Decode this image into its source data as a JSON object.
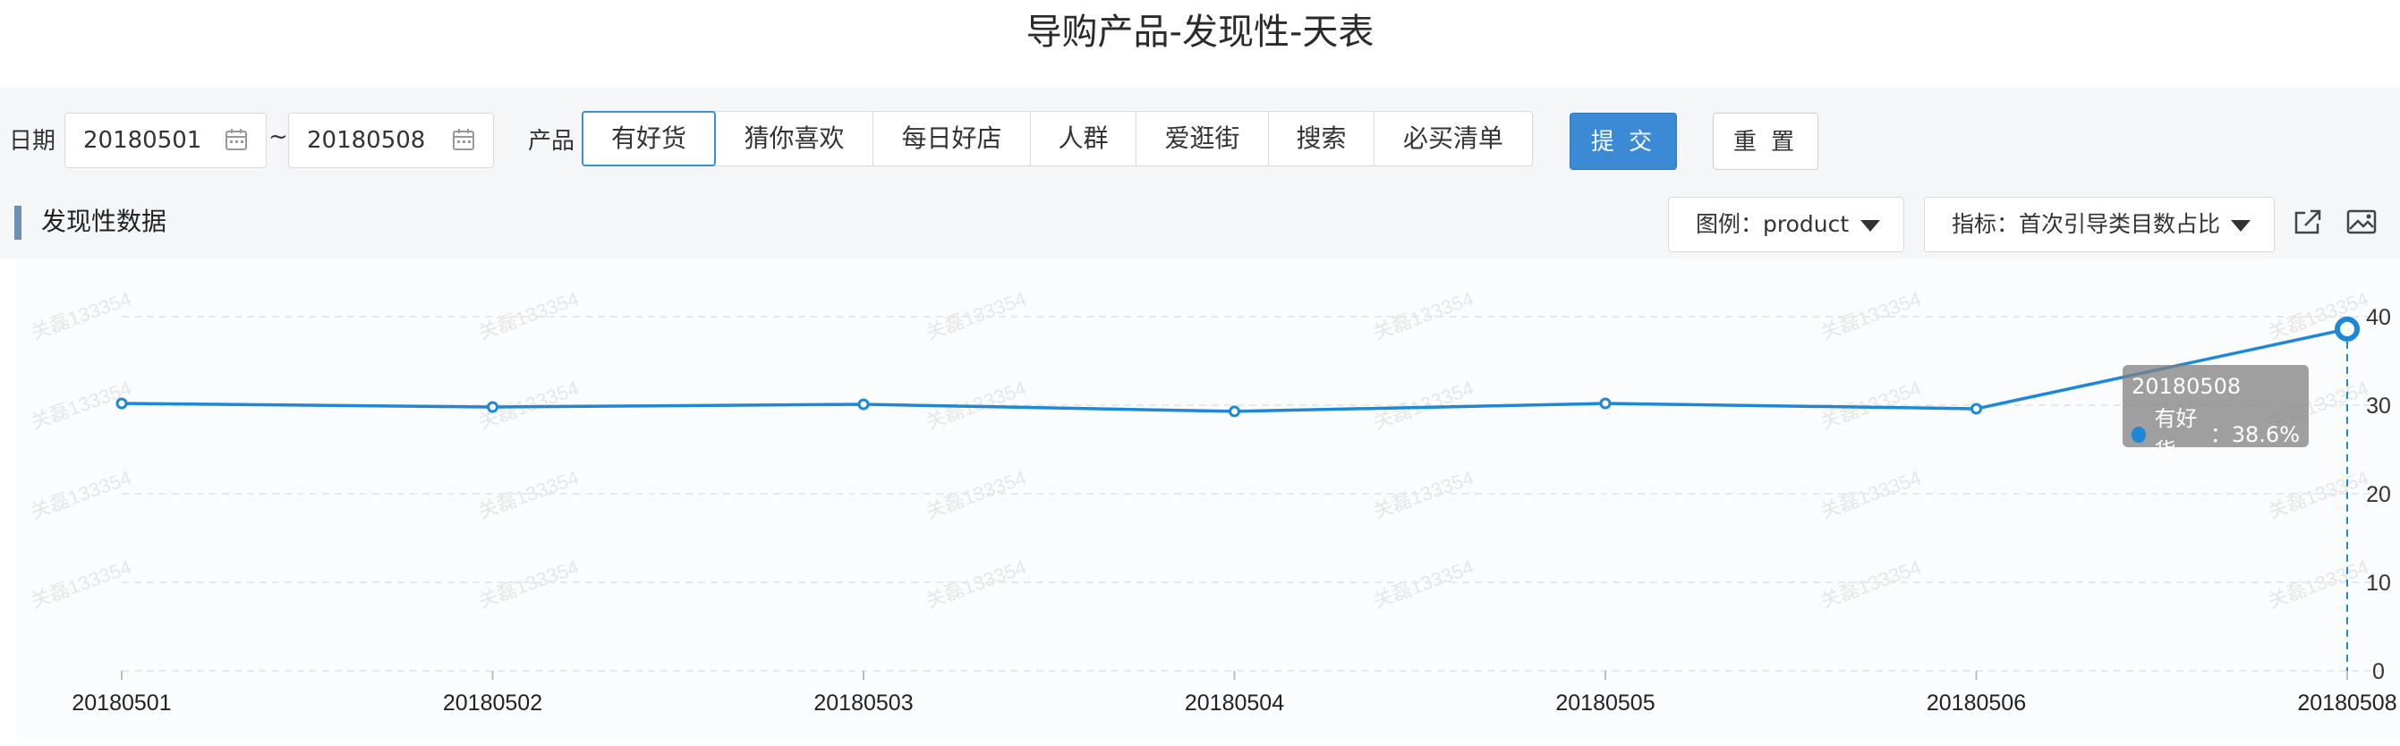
{
  "page": {
    "title": "导购产品-发现性-天表"
  },
  "filters": {
    "date_label": "日期",
    "start_date": "20180501",
    "end_date": "20180508",
    "separator": "~",
    "product_label": "产品",
    "products": [
      "有好货",
      "猜你喜欢",
      "每日好店",
      "人群",
      "爱逛街",
      "搜索",
      "必买清单"
    ],
    "active_product": "有好货",
    "submit_label": "提 交",
    "reset_label": "重 置"
  },
  "section": {
    "title": "发现性数据",
    "legend_dropdown": "图例：product",
    "metric_dropdown": "指标：首次引导类目数占比"
  },
  "icons": {
    "calendar": "calendar-icon",
    "export": "export-icon",
    "save_image": "image-icon",
    "dropdown": "caret-down-icon"
  },
  "colors": {
    "accent": "#3c8ad6",
    "series": "#1e88d6",
    "page_background": "#f5f6f8",
    "tooltip_bg": "#8c8c8c"
  },
  "watermark": "关磊133354",
  "chart_data": {
    "type": "line",
    "title": "",
    "xlabel": "",
    "ylabel": "",
    "x": [
      "20180501",
      "20180502",
      "20180503",
      "20180504",
      "20180505",
      "20180506",
      "20180508"
    ],
    "series": [
      {
        "name": "有好货",
        "values": [
          30.2,
          29.8,
          30.1,
          29.3,
          30.2,
          29.6,
          38.6
        ]
      }
    ],
    "ylim": [
      0,
      40
    ],
    "yticks": [
      0,
      10,
      20,
      30,
      40
    ],
    "grid": true,
    "tooltip": {
      "date": "20180508",
      "series_name": "有好货",
      "value_text": "38.6%"
    }
  }
}
